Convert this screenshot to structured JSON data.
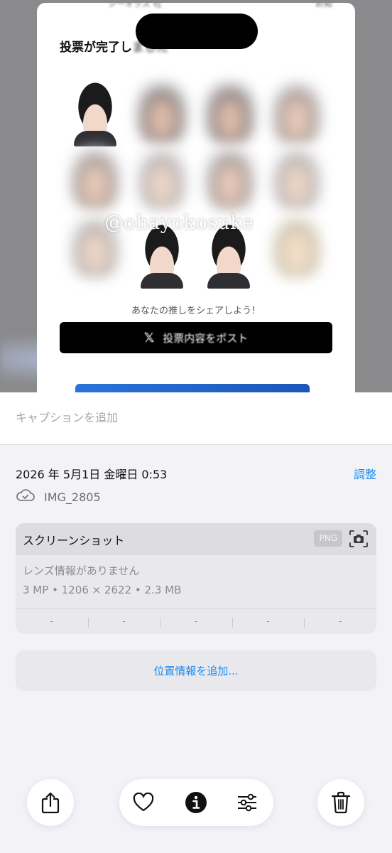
{
  "photo": {
    "card_title": "投票が完了し",
    "card_title_obscured": "ました",
    "top_peek": "シーオッズ 社　　　　　　　　　　　　　　　　　　お知",
    "watermark": "@ohayokosuke",
    "share_hint": "あなたの推しをシェアしよう！",
    "post_button_icon": "x-logo-icon",
    "post_button_label": "投票内容をポスト"
  },
  "caption": {
    "placeholder": "キャプションを追加"
  },
  "info": {
    "datetime": "2026 年 5月1日 金曜日 0:53",
    "adjust_label": "調整",
    "cloud_icon": "icloud-check-icon",
    "filename": "IMG_2805"
  },
  "metadata": {
    "title": "スクリーンショット",
    "format_badge": "PNG",
    "camera_icon": "camera-viewfinder-icon",
    "lens": "レンズ情報がありません",
    "specs": "3 MP • 1206 × 2622 • 2.3 MB",
    "exif": [
      "-",
      "-",
      "-",
      "-",
      "-"
    ]
  },
  "location": {
    "label": "位置情報を追加..."
  },
  "toolbar": {
    "share_icon": "share-icon",
    "favorite_icon": "heart-icon",
    "info_icon": "info-icon",
    "edit_icon": "sliders-icon",
    "delete_icon": "trash-icon"
  },
  "colors": {
    "accent": "#1a8cf0",
    "background": "#f2f2f7",
    "card": "#e8e8ed"
  }
}
